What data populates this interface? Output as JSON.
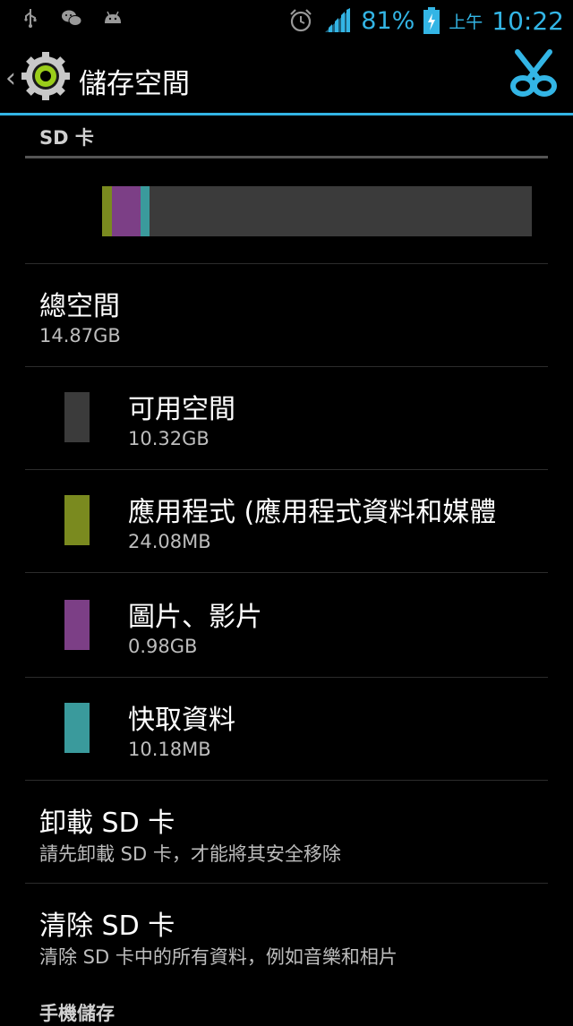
{
  "status_bar": {
    "icons_left": [
      "usb-icon",
      "wechat-icon",
      "android-icon"
    ],
    "battery_pct": "81%",
    "ampm": "上午",
    "time": "10:22",
    "accent": "#33b5e5"
  },
  "action_bar": {
    "back": "‹",
    "title": "儲存空間"
  },
  "sd_section": {
    "header": "SD 卡",
    "usage": [
      {
        "name": "應用程式",
        "fraction": 0.023,
        "color": "#7a8a1f"
      },
      {
        "name": "圖片、影片",
        "fraction": 0.066,
        "color": "#7c3f86"
      },
      {
        "name": "快取資料",
        "fraction": 0.021,
        "color": "#3a9a9c"
      }
    ],
    "total": {
      "label": "總空間",
      "value": "14.87GB"
    },
    "items": [
      {
        "label": "可用空間",
        "value": "10.32GB",
        "color": "#3b3b3b"
      },
      {
        "label": "應用程式 (應用程式資料和媒體",
        "value": "24.08MB",
        "color": "#7a8a1f"
      },
      {
        "label": "圖片、影片",
        "value": "0.98GB",
        "color": "#7c3f86"
      },
      {
        "label": "快取資料",
        "value": "10.18MB",
        "color": "#3a9a9c"
      }
    ],
    "unmount": {
      "title": "卸載 SD 卡",
      "subtitle": "請先卸載 SD 卡，才能將其安全移除"
    },
    "erase": {
      "title": "清除 SD 卡",
      "subtitle": "清除 SD 卡中的所有資料，例如音樂和相片"
    }
  },
  "phone_section": {
    "header": "手機儲存"
  }
}
